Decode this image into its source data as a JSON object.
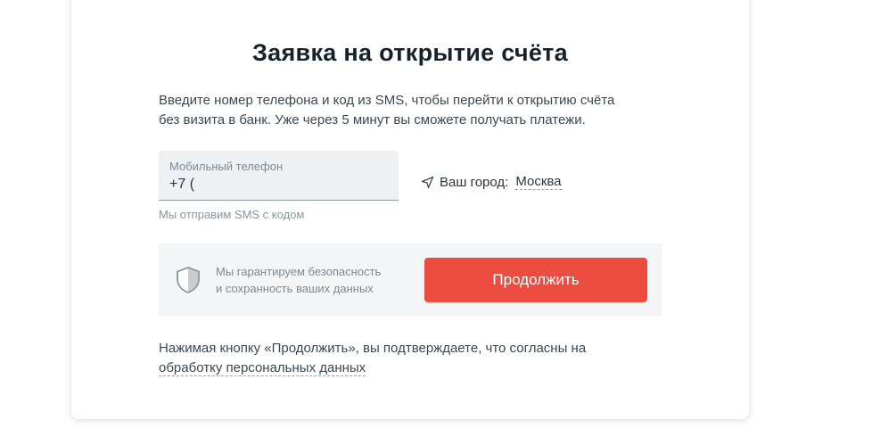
{
  "form": {
    "title": "Заявка на открытие счёта",
    "intro_line1": "Введите номер телефона и код из SMS, чтобы перейти к открытию счёта",
    "intro_line2": "без визита в банк. Уже через 5 минут вы сможете получать платежи.",
    "phone": {
      "label": "Мобильный телефон",
      "value": "+7 (",
      "hint": "Мы отправим SMS с кодом"
    },
    "city": {
      "label": "Ваш город:",
      "value": "Москва",
      "icon": "location-arrow-icon"
    },
    "security": {
      "icon": "shield-icon",
      "line1": "Мы гарантируем безопасность",
      "line2": "и сохранность ваших данных"
    },
    "continue_label": "Продолжить",
    "consent_text": "Нажимая кнопку «Продолжить», вы подтверждаете, что согласны на",
    "consent_link": "обработку персональных данных"
  },
  "colors": {
    "accent_button": "#ed4c40",
    "panel_background": "#f3f5f6",
    "field_background": "#eef1f3"
  }
}
